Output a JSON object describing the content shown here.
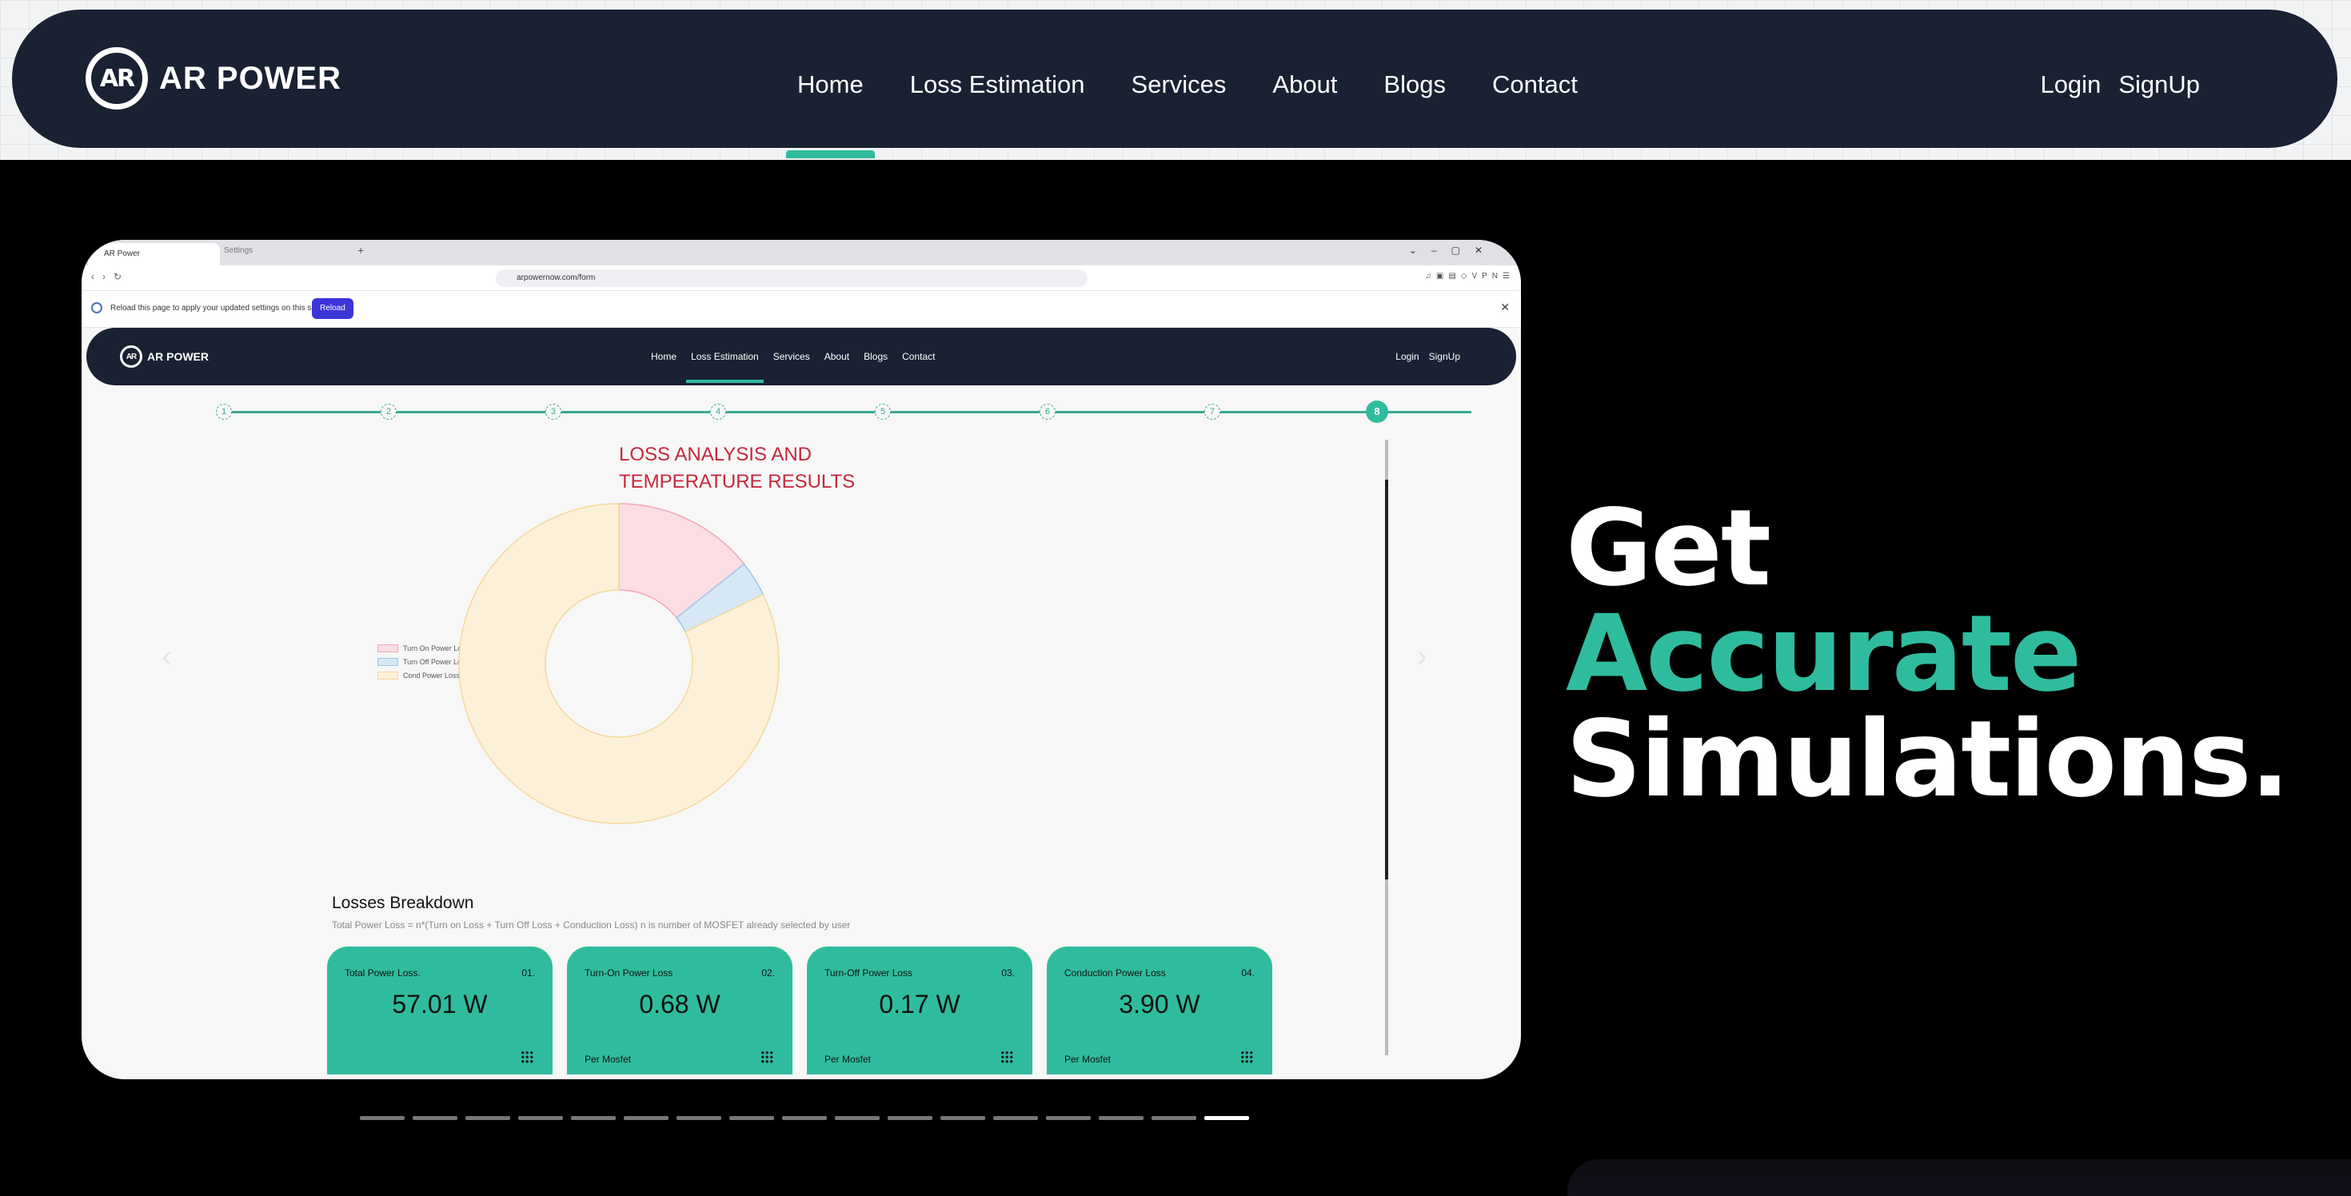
{
  "header": {
    "brand": "AR POWER",
    "logo_text": "AR",
    "nav": [
      "Home",
      "Loss Estimation",
      "Services",
      "About",
      "Blogs",
      "Contact"
    ],
    "active_nav": "Home",
    "login": "Login",
    "signup": "SignUp"
  },
  "screenshot": {
    "browser": {
      "tab_active": "AR Power",
      "tab_inactive": "Settings",
      "url": "arpowernow.com/form",
      "infobar_text": "Reload this page to apply your updated settings on this site",
      "reload_label": "Reload",
      "vpn_label": "VPN"
    },
    "site_nav": {
      "brand": "AR POWER",
      "logo_text": "AR",
      "links": [
        "Home",
        "Loss Estimation",
        "Services",
        "About",
        "Blogs",
        "Contact"
      ],
      "active": "Loss Estimation",
      "login": "Login",
      "signup": "SignUp"
    },
    "stepper": {
      "steps": [
        "1",
        "2",
        "3",
        "4",
        "5",
        "6",
        "7",
        "8"
      ],
      "current": "8"
    },
    "chart_title_line1": "LOSS ANALYSIS AND",
    "chart_title_line2": "TEMPERATURE RESULTS",
    "chart_data": {
      "type": "pie",
      "variant": "donut",
      "categories": [
        "Turn On Power Loss/Mosfet",
        "Turn Off Power Loss/Mosfet",
        "Cond Power Loss/Mosfet"
      ],
      "values": [
        0.68,
        0.17,
        3.9
      ],
      "colors": [
        "#fbdde4",
        "#d6e8f5",
        "#fcf0d8"
      ],
      "border_colors": [
        "#f2a7b8",
        "#9cc5e8",
        "#f4d89a"
      ],
      "legend_position": "left"
    },
    "losses": {
      "title": "Losses Breakdown",
      "description": "Total Power Loss = n*(Turn on Loss + Turn Off Loss + Conduction Loss) n is number of MOSFET already selected by user",
      "cards": [
        {
          "label": "Total Power Loss.",
          "num": "01.",
          "value": "57.01 W",
          "sub": ""
        },
        {
          "label": "Turn-On Power Loss",
          "num": "02.",
          "value": "0.68 W",
          "sub": "Per Mosfet"
        },
        {
          "label": "Turn-Off Power Loss",
          "num": "03.",
          "value": "0.17 W",
          "sub": "Per Mosfet"
        },
        {
          "label": "Conduction Power Loss",
          "num": "04.",
          "value": "3.90 W",
          "sub": "Per Mosfet"
        }
      ]
    }
  },
  "headline": {
    "line1": "Get",
    "line2": "Accurate",
    "line3": "Simulations."
  },
  "carousel": {
    "slide_count": 17,
    "active_index": 16
  }
}
